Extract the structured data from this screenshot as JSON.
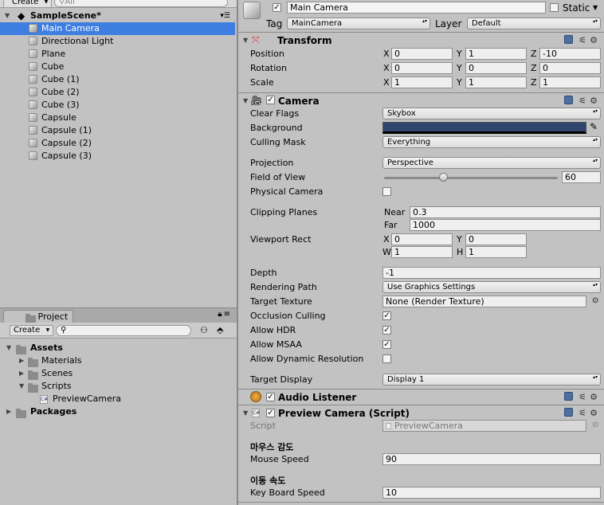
{
  "hierarchy": {
    "create_label": "Create",
    "search_placeholder": "All",
    "scene_name": "SampleScene*",
    "items": [
      "Main Camera",
      "Directional Light",
      "Plane",
      "Cube",
      "Cube (1)",
      "Cube (2)",
      "Cube (3)",
      "Capsule",
      "Capsule (1)",
      "Capsule (2)",
      "Capsule (3)"
    ],
    "selected": "Main Camera"
  },
  "project": {
    "tab_label": "Project",
    "create_label": "Create",
    "tree": {
      "assets": "Assets",
      "materials": "Materials",
      "scenes": "Scenes",
      "scripts": "Scripts",
      "preview_camera": "PreviewCamera",
      "packages": "Packages"
    }
  },
  "inspector": {
    "object_name": "Main Camera",
    "static_label": "Static",
    "tag_label": "Tag",
    "tag_value": "MainCamera",
    "layer_label": "Layer",
    "layer_value": "Default",
    "transform": {
      "title": "Transform",
      "rows": [
        {
          "label": "Position",
          "x": "0",
          "y": "1",
          "z": "-10"
        },
        {
          "label": "Rotation",
          "x": "0",
          "y": "0",
          "z": "0"
        },
        {
          "label": "Scale",
          "x": "1",
          "y": "1",
          "z": "1"
        }
      ],
      "axis": {
        "x": "X",
        "y": "Y",
        "z": "Z"
      }
    },
    "camera": {
      "title": "Camera",
      "clear_flags_label": "Clear Flags",
      "clear_flags_value": "Skybox",
      "background_label": "Background",
      "background_color": "#30466f",
      "culling_mask_label": "Culling Mask",
      "culling_mask_value": "Everything",
      "projection_label": "Projection",
      "projection_value": "Perspective",
      "fov_label": "Field of View",
      "fov_value": "60",
      "fov_slider_fraction": 0.34,
      "physical_label": "Physical Camera",
      "clipping_label": "Clipping Planes",
      "near_label": "Near",
      "near_value": "0.3",
      "far_label": "Far",
      "far_value": "1000",
      "viewport_label": "Viewport Rect",
      "vp_x_label": "X",
      "vp_x": "0",
      "vp_y_label": "Y",
      "vp_y": "0",
      "vp_w_label": "W",
      "vp_w": "1",
      "vp_h_label": "H",
      "vp_h": "1",
      "depth_label": "Depth",
      "depth_value": "-1",
      "rendering_path_label": "Rendering Path",
      "rendering_path_value": "Use Graphics Settings",
      "target_texture_label": "Target Texture",
      "target_texture_value": "None (Render Texture)",
      "occlusion_label": "Occlusion Culling",
      "hdr_label": "Allow HDR",
      "msaa_label": "Allow MSAA",
      "dyn_res_label": "Allow Dynamic Resolution",
      "target_display_label": "Target Display",
      "target_display_value": "Display 1"
    },
    "audio_listener": {
      "title": "Audio Listener"
    },
    "preview_script": {
      "title": "Preview Camera (Script)",
      "script_label": "Script",
      "script_value": "PreviewCamera",
      "header1": "마우스 감도",
      "mouse_speed_label": "Mouse Speed",
      "mouse_speed_value": "90",
      "header2": "이동 속도",
      "key_speed_label": "Key Board Speed",
      "key_speed_value": "10"
    }
  },
  "colors": {
    "selection": "#3e7ee0",
    "panel": "#c2c2c2"
  }
}
